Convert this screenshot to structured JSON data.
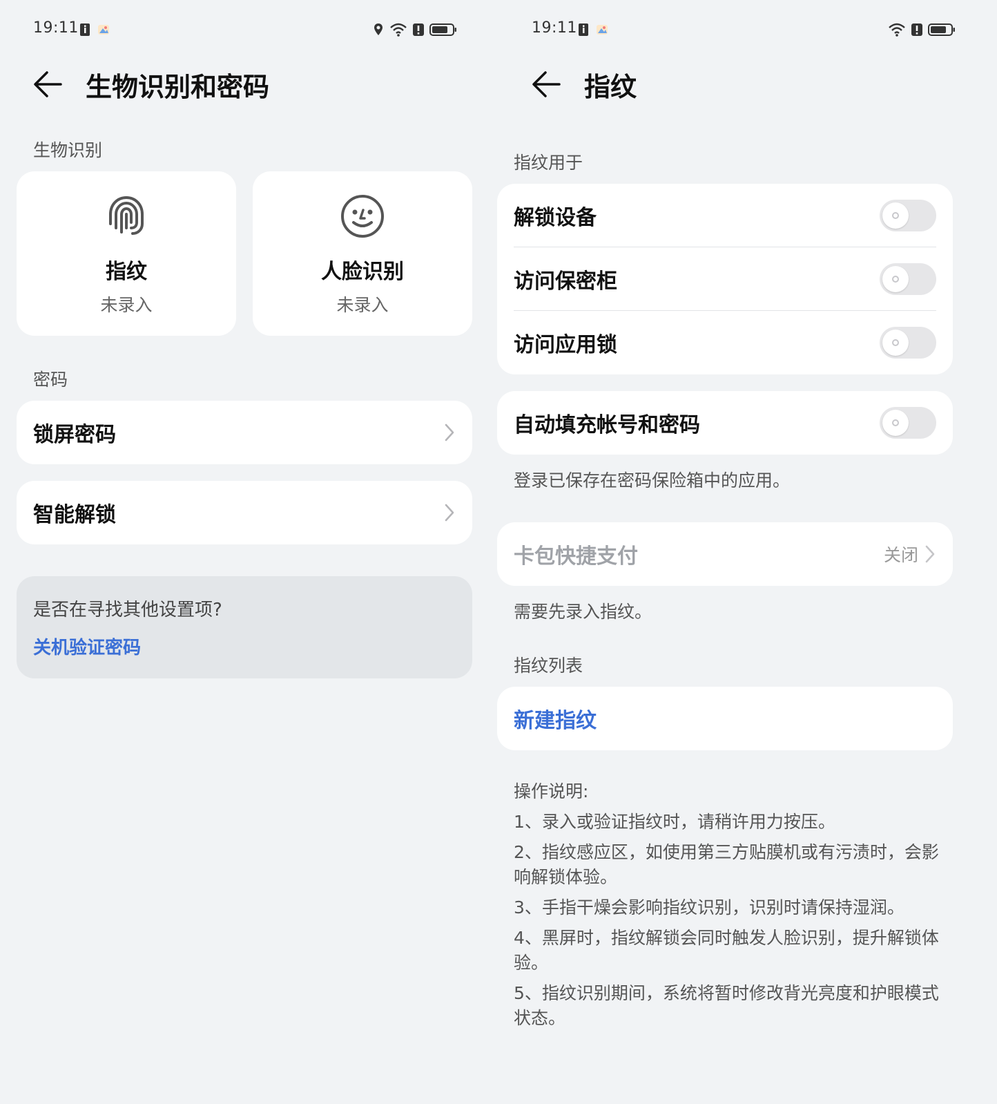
{
  "left": {
    "status": {
      "time": "19:11"
    },
    "header": {
      "title": "生物识别和密码"
    },
    "biometrics": {
      "section_label": "生物识别",
      "fingerprint": {
        "name": "指纹",
        "status": "未录入"
      },
      "face": {
        "name": "人脸识别",
        "status": "未录入"
      }
    },
    "password": {
      "section_label": "密码",
      "lock_screen": "锁屏密码",
      "smart_unlock": "智能解锁"
    },
    "hint": {
      "question": "是否在寻找其他设置项?",
      "link": "关机验证密码"
    }
  },
  "right": {
    "status": {
      "time": "19:11"
    },
    "header": {
      "title": "指纹"
    },
    "usage": {
      "section_label": "指纹用于",
      "unlock_device": "解锁设备",
      "access_safe": "访问保密柜",
      "access_applock": "访问应用锁"
    },
    "autofill": {
      "label": "自动填充帐号和密码",
      "desc": "登录已保存在密码保险箱中的应用。"
    },
    "wallet": {
      "label": "卡包快捷支付",
      "value": "关闭",
      "desc": "需要先录入指纹。"
    },
    "list": {
      "section_label": "指纹列表",
      "new": "新建指纹"
    },
    "instructions": {
      "title": "操作说明:",
      "items": [
        "1、录入或验证指纹时，请稍许用力按压。",
        "2、指纹感应区，如使用第三方贴膜机或有污渍时，会影响解锁体验。",
        "3、手指干燥会影响指纹识别，识别时请保持湿润。",
        "4、黑屏时，指纹解锁会同时触发人脸识别，提升解锁体验。",
        "5、指纹识别期间，系统将暂时修改背光亮度和护眼模式状态。"
      ]
    }
  },
  "colors": {
    "background": "#f1f3f5",
    "card": "#ffffff",
    "accent_blue": "#3b6fd6",
    "hint_box": "#e3e6e9"
  },
  "icons": [
    "back-arrow-icon",
    "fingerprint-icon",
    "face-smile-icon",
    "chevron-right-icon",
    "location-icon",
    "wifi-icon",
    "alert-icon",
    "battery-icon",
    "notification-i-icon",
    "gallery-icon"
  ]
}
